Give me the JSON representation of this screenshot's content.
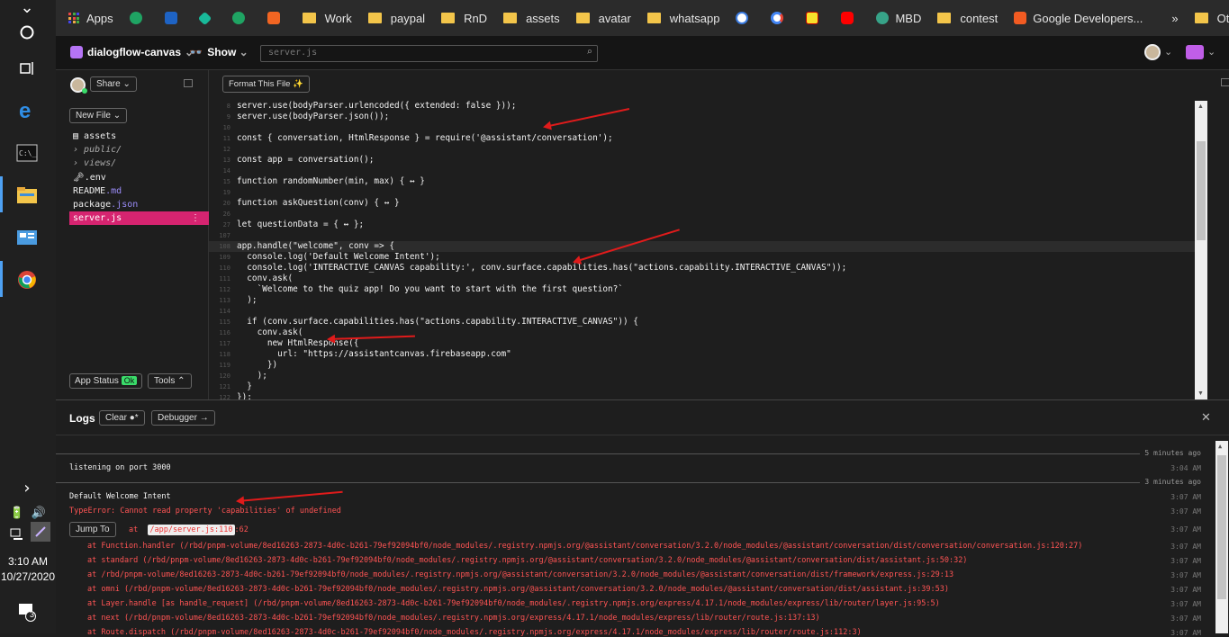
{
  "taskbar": {
    "time": "3:10 AM",
    "date": "10/27/2020",
    "notifications": "3"
  },
  "bookmarks": {
    "apps": "Apps",
    "items": [
      {
        "label": "Work",
        "type": "folder"
      },
      {
        "label": "paypal",
        "type": "folder"
      },
      {
        "label": "RnD",
        "type": "folder"
      },
      {
        "label": "assets",
        "type": "folder"
      },
      {
        "label": "avatar",
        "type": "folder"
      },
      {
        "label": "whatsapp",
        "type": "folder"
      },
      {
        "label": "MBD",
        "type": "site"
      },
      {
        "label": "contest",
        "type": "folder"
      },
      {
        "label": "Google Developers...",
        "type": "site"
      }
    ],
    "more": "»",
    "other": "Other bookmarks"
  },
  "header": {
    "project_name": "dialogflow-canvas",
    "show_label": "Show",
    "search_placeholder": "server.js"
  },
  "sidebar": {
    "share_label": "Share",
    "new_file_label": "New File",
    "files": [
      {
        "name": "assets",
        "ext": "",
        "style": "normal"
      },
      {
        "name": "public/",
        "ext": "",
        "style": "dim"
      },
      {
        "name": "views/",
        "ext": "",
        "style": "dim"
      },
      {
        "name": ".env",
        "ext": "",
        "style": "normal"
      },
      {
        "name": "README",
        "ext": ".md",
        "style": "normal"
      },
      {
        "name": "package",
        "ext": ".json",
        "style": "normal"
      },
      {
        "name": "server.js",
        "ext": "",
        "style": "selected"
      }
    ],
    "app_status_label": "App Status",
    "app_status_value": "Ok",
    "tools_label": "Tools"
  },
  "editor": {
    "format_label": "Format This File",
    "lines": [
      {
        "n": "8",
        "code": "server.use(bodyParser.urlencoded({ extended: false }));"
      },
      {
        "n": "9",
        "code": "server.use(bodyParser.json());"
      },
      {
        "n": "10",
        "code": ""
      },
      {
        "n": "11",
        "code": "const { conversation, HtmlResponse } = require('@assistant/conversation');"
      },
      {
        "n": "12",
        "code": ""
      },
      {
        "n": "13",
        "code": "const app = conversation();"
      },
      {
        "n": "14",
        "code": ""
      },
      {
        "n": "15",
        "code": "function randomNumber(min, max) { ↔ }"
      },
      {
        "n": "19",
        "code": ""
      },
      {
        "n": "20",
        "code": "function askQuestion(conv) { ↔ }"
      },
      {
        "n": "26",
        "code": ""
      },
      {
        "n": "27",
        "code": "let questionData = { ↔ };"
      },
      {
        "n": "107",
        "code": ""
      },
      {
        "n": "108",
        "code": "app.handle(\"welcome\", conv => {"
      },
      {
        "n": "109",
        "code": "  console.log('Default Welcome Intent');"
      },
      {
        "n": "110",
        "code": "  console.log('INTERACTIVE_CANVAS capability:', conv.surface.capabilities.has(\"actions.capability.INTERACTIVE_CANVAS\"));"
      },
      {
        "n": "111",
        "code": "  conv.ask("
      },
      {
        "n": "112",
        "code": "    `Welcome to the quiz app! Do you want to start with the first question?`"
      },
      {
        "n": "113",
        "code": "  );"
      },
      {
        "n": "114",
        "code": ""
      },
      {
        "n": "115",
        "code": "  if (conv.surface.capabilities.has(\"actions.capability.INTERACTIVE_CANVAS\")) {"
      },
      {
        "n": "116",
        "code": "    conv.ask("
      },
      {
        "n": "117",
        "code": "      new HtmlResponse({"
      },
      {
        "n": "118",
        "code": "        url: \"https://assistantcanvas.firebaseapp.com\""
      },
      {
        "n": "119",
        "code": "      })"
      },
      {
        "n": "120",
        "code": "    );"
      },
      {
        "n": "121",
        "code": "  }"
      },
      {
        "n": "122",
        "code": "});"
      }
    ]
  },
  "logs": {
    "title": "Logs",
    "clear_label": "Clear",
    "debugger_label": "Debugger",
    "sep1": "5 minutes ago",
    "listening": "listening on port 3000",
    "listening_ts": "3:04 AM",
    "sep2": "3 minutes ago",
    "welcome": "Default Welcome Intent",
    "welcome_ts": "3:07 AM",
    "error": "TypeError: Cannot read property 'capabilities' of undefined",
    "error_ts": "3:07 AM",
    "jump_label": "Jump To",
    "at_label": "at",
    "jump_path": "/app/server.js:110",
    "jump_col": ":62",
    "jump_ts": "3:07 AM",
    "stack": [
      {
        "text": "at Function.handler (/rbd/pnpm-volume/8ed16263-2873-4d0c-b261-79ef92094bf0/node_modules/.registry.npmjs.org/@assistant/conversation/3.2.0/node_modules/@assistant/conversation/dist/conversation/conversation.js:120:27)",
        "ts": "3:07 AM"
      },
      {
        "text": "at standard (/rbd/pnpm-volume/8ed16263-2873-4d0c-b261-79ef92094bf0/node_modules/.registry.npmjs.org/@assistant/conversation/3.2.0/node_modules/@assistant/conversation/dist/assistant.js:50:32)",
        "ts": "3:07 AM"
      },
      {
        "text": "at /rbd/pnpm-volume/8ed16263-2873-4d0c-b261-79ef92094bf0/node_modules/.registry.npmjs.org/@assistant/conversation/3.2.0/node_modules/@assistant/conversation/dist/framework/express.js:29:13",
        "ts": "3:07 AM"
      },
      {
        "text": "at omni (/rbd/pnpm-volume/8ed16263-2873-4d0c-b261-79ef92094bf0/node_modules/.registry.npmjs.org/@assistant/conversation/3.2.0/node_modules/@assistant/conversation/dist/assistant.js:39:53)",
        "ts": "3:07 AM"
      },
      {
        "text": "at Layer.handle [as handle_request] (/rbd/pnpm-volume/8ed16263-2873-4d0c-b261-79ef92094bf0/node_modules/.registry.npmjs.org/express/4.17.1/node_modules/express/lib/router/layer.js:95:5)",
        "ts": "3:07 AM"
      },
      {
        "text": "at next (/rbd/pnpm-volume/8ed16263-2873-4d0c-b261-79ef92094bf0/node_modules/.registry.npmjs.org/express/4.17.1/node_modules/express/lib/router/route.js:137:13)",
        "ts": "3:07 AM"
      },
      {
        "text": "at Route.dispatch (/rbd/pnpm-volume/8ed16263-2873-4d0c-b261-79ef92094bf0/node_modules/.registry.npmjs.org/express/4.17.1/node_modules/express/lib/router/route.js:112:3)",
        "ts": "3:07 AM"
      }
    ]
  }
}
